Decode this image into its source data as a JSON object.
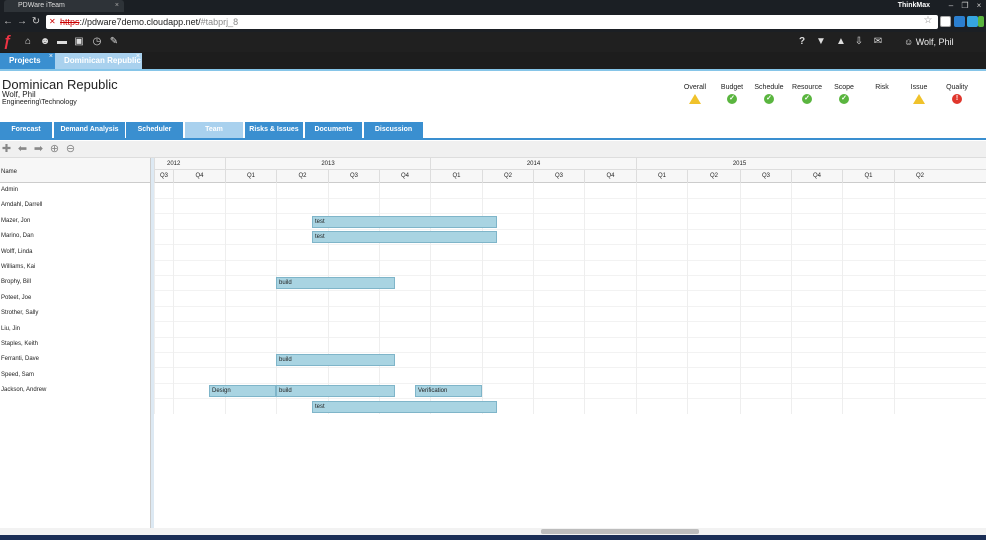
{
  "browser": {
    "tab_title": "PDWare iTeam",
    "brand": "ThinkMax",
    "url_scheme": "https",
    "url_host": "://pdware7demo.cloudapp.net/",
    "url_path": "#tabprj_8"
  },
  "app": {
    "user_name": "Wolf, Phil"
  },
  "project_tabs": [
    {
      "label": "Projects"
    },
    {
      "label": "Dominican Republic"
    }
  ],
  "project": {
    "title": "Dominican Republic",
    "owner": "Wolf, Phil",
    "department": "Engineering\\Technology"
  },
  "status_indicators": [
    {
      "label": "Overall",
      "state": "warning"
    },
    {
      "label": "Budget",
      "state": "ok"
    },
    {
      "label": "Schedule",
      "state": "ok"
    },
    {
      "label": "Resource",
      "state": "ok"
    },
    {
      "label": "Scope",
      "state": "ok"
    },
    {
      "label": "Risk",
      "state": "none"
    },
    {
      "label": "Issue",
      "state": "warning"
    },
    {
      "label": "Quality",
      "state": "critical"
    }
  ],
  "section_tabs": [
    {
      "label": "Forecast"
    },
    {
      "label": "Demand Analysis"
    },
    {
      "label": "Scheduler"
    },
    {
      "label": "Team",
      "active": true
    },
    {
      "label": "Risks & Issues"
    },
    {
      "label": "Documents"
    },
    {
      "label": "Discussion"
    }
  ],
  "grid": {
    "name_header": "Name",
    "years": [
      "2012",
      "2013",
      "2014",
      "2015"
    ],
    "quarters": [
      "Q3",
      "Q4",
      "Q1",
      "Q2",
      "Q3",
      "Q4",
      "Q1",
      "Q2",
      "Q3",
      "Q4",
      "Q1",
      "Q2",
      "Q3",
      "Q4",
      "Q1",
      "Q2"
    ],
    "rows": [
      {
        "name": "Admin"
      },
      {
        "name": "Amdahl, Darrell"
      },
      {
        "name": "Mazer, Jon"
      },
      {
        "name": "Marino, Dan"
      },
      {
        "name": "Wolff, Linda"
      },
      {
        "name": "Williams, Kai"
      },
      {
        "name": "Brophy, Bill"
      },
      {
        "name": "Poteet, Joe"
      },
      {
        "name": "Strother, Sally"
      },
      {
        "name": "Liu, Jin"
      },
      {
        "name": "Staples, Keith"
      },
      {
        "name": "Ferranti, Dave"
      },
      {
        "name": "Speed, Sam"
      },
      {
        "name": "Jackson, Andrew"
      }
    ],
    "assignments": [
      {
        "person": "Mazer, Jon",
        "task": "test"
      },
      {
        "person": "Marino, Dan",
        "task": "test"
      },
      {
        "person": "Brophy, Bill",
        "task": "build"
      },
      {
        "person": "Ferranti, Dave",
        "task": "build"
      },
      {
        "person": "Jackson, Andrew",
        "task": "Design"
      },
      {
        "person": "Jackson, Andrew",
        "task": "build"
      },
      {
        "person": "Jackson, Andrew",
        "task": "Verification"
      },
      {
        "person": "Jackson, Andrew",
        "task": "test"
      }
    ]
  }
}
